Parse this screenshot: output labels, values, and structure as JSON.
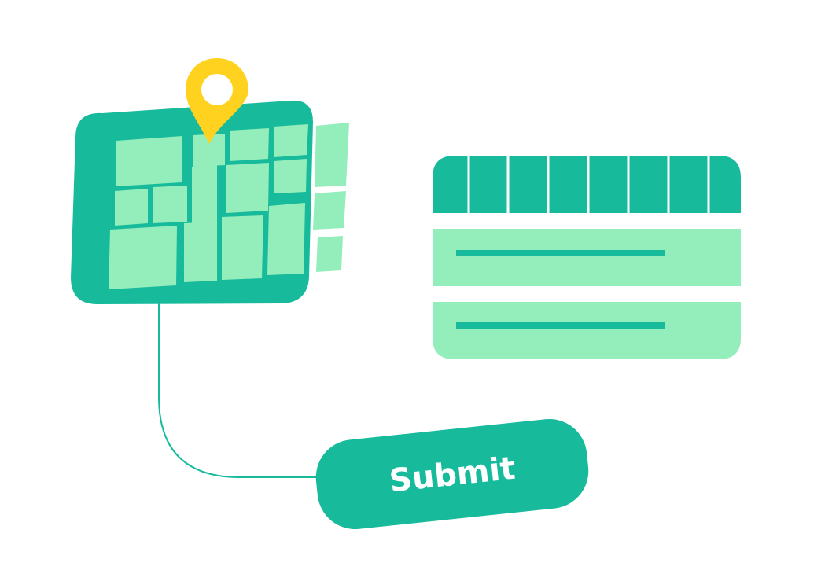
{
  "submit_button": {
    "label": "Submit"
  },
  "icons": {
    "map": "map-icon",
    "pin": "location-pin-icon",
    "table": "table-icon",
    "connector": "connector-line"
  },
  "colors": {
    "primary": "#17BB9C",
    "light": "#94EEBB",
    "pin": "#FFD21F",
    "text_on_primary": "#FFFFFF",
    "background": "#FFFFFF"
  },
  "table": {
    "header_columns": 8,
    "rows": 2
  }
}
